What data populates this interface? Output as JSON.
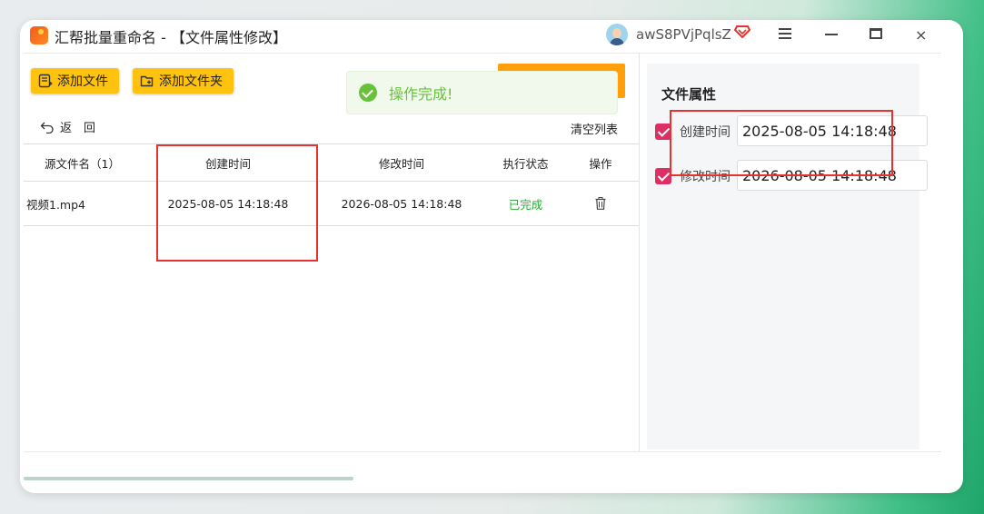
{
  "app": {
    "title": "汇帮批量重命名 - 【文件属性修改】",
    "username": "awS8PVjPqlsZ"
  },
  "toolbar": {
    "add_file": "添加文件",
    "add_folder": "添加文件夹",
    "back": "返　回",
    "clear_list": "清空列表"
  },
  "toast": {
    "message": "操作完成!"
  },
  "table": {
    "headers": [
      "源文件名（1）",
      "创建时间",
      "修改时间",
      "执行状态",
      "操作"
    ],
    "rows": [
      {
        "name": "视频1.mp4",
        "created": "2025-08-05 14:18:48",
        "modified": "2026-08-05 14:18:48",
        "status": "已完成"
      }
    ]
  },
  "panel": {
    "title": "文件属性",
    "created_label": "创建时间",
    "created_value": "2025-08-05 14:18:48",
    "created_checked": true,
    "modified_label": "修改时间",
    "modified_value": "2026-08-05 14:18:48",
    "modified_checked": true
  },
  "colors": {
    "accent_yellow": "#ffc20e",
    "accent_orange": "#ff9f0a",
    "success_green": "#67c23a",
    "checkbox_pink": "#dc2f63",
    "annotation_red": "#e8322e"
  },
  "icons": [
    "app-logo-icon",
    "avatar",
    "vip-diamond-icon",
    "menu-icon",
    "minimize-icon",
    "maximize-icon",
    "close-icon",
    "add-file-icon",
    "add-folder-icon",
    "success-check-icon",
    "back-arrow-icon",
    "trash-icon",
    "checkbox-checked-icon"
  ]
}
